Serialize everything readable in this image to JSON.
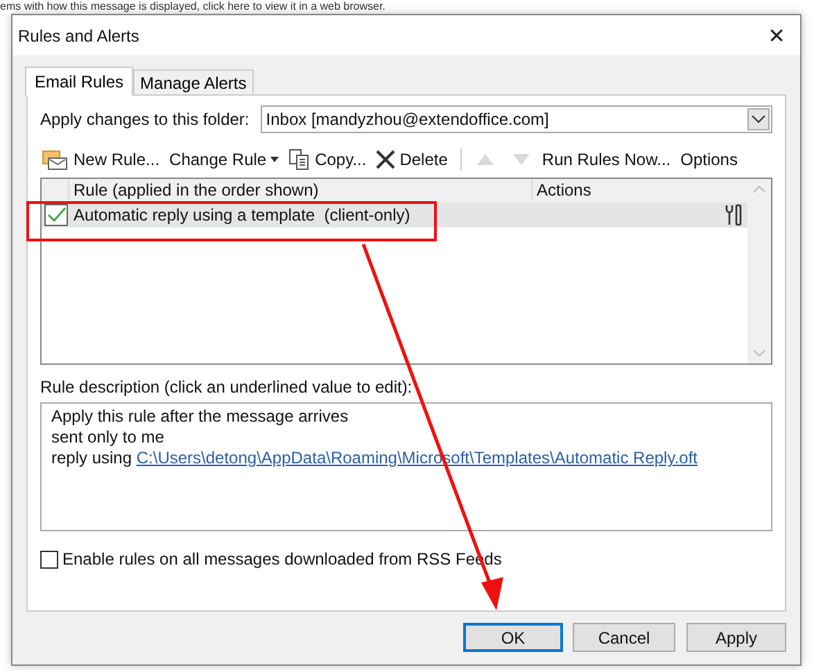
{
  "background_text": "ems with how this message is displayed, click here to view it in a web browser.",
  "window": {
    "title": "Rules and Alerts",
    "close": "✕"
  },
  "tabs": [
    {
      "label": "Email Rules",
      "selected": true
    },
    {
      "label": "Manage Alerts",
      "selected": false
    }
  ],
  "folder": {
    "label": "Apply changes to this folder:",
    "value": "Inbox [mandyzhou@extendoffice.com]"
  },
  "toolbar": [
    {
      "kind": "new",
      "label": "New Rule..."
    },
    {
      "kind": "change",
      "label": "Change Rule"
    },
    {
      "kind": "copy",
      "label": "Copy..."
    },
    {
      "kind": "delete",
      "label": "Delete"
    },
    {
      "kind": "up",
      "disabled": true
    },
    {
      "kind": "down",
      "disabled": true
    },
    {
      "kind": "text",
      "label": "Run Rules Now..."
    },
    {
      "kind": "text",
      "label": "Options"
    }
  ],
  "table": {
    "columns": [
      "Rule (applied in the order shown)",
      "Actions"
    ],
    "rows": [
      {
        "rule": "Automatic reply using a template  (client-only)",
        "checked": true,
        "selected": true
      }
    ]
  },
  "description": {
    "label": "Rule description (click an underlined value to edit):",
    "lines": [
      {
        "text": "Apply this rule after the message arrives"
      },
      {
        "text": "sent only to me"
      },
      {
        "text": "reply using ",
        "link": "C:\\Users\\detong\\AppData\\Roaming\\Microsoft\\Templates\\Automatic Reply.oft"
      }
    ]
  },
  "rss": {
    "label": "Enable rules on all messages downloaded from RSS Feeds",
    "checked": false
  },
  "buttons": [
    {
      "label": "OK",
      "default": true
    },
    {
      "label": "Cancel",
      "default": false
    },
    {
      "label": "Apply",
      "default": false
    }
  ]
}
